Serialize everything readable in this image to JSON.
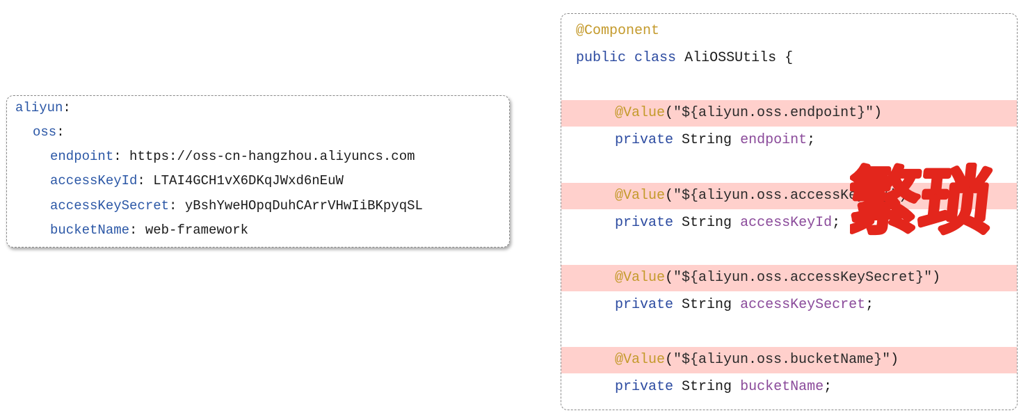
{
  "yaml": {
    "root_key": "aliyun",
    "oss_key": "oss",
    "entries": [
      {
        "key": "endpoint",
        "value": "https://oss-cn-hangzhou.aliyuncs.com"
      },
      {
        "key": "accessKeyId",
        "value": "LTAI4GCH1vX6DKqJWxd6nEuW"
      },
      {
        "key": "accessKeySecret",
        "value": "yBshYweHOpqDuhCArrVHwIiBKpyqSL"
      },
      {
        "key": "bucketName",
        "value": "web-framework"
      }
    ]
  },
  "code": {
    "annotation_component": "@Component",
    "class_decl": {
      "modifier": "public",
      "keyword": "class",
      "name": "AliOSSUtils",
      "brace": "{"
    },
    "fields": [
      {
        "annotation": "@Value",
        "expr": "\"${aliyun.oss.endpoint}\"",
        "modifier": "private",
        "type": "String",
        "name": "endpoint"
      },
      {
        "annotation": "@Value",
        "expr": "\"${aliyun.oss.accessKeyId}\"",
        "modifier": "private",
        "type": "String",
        "name": "accessKeyId"
      },
      {
        "annotation": "@Value",
        "expr": "\"${aliyun.oss.accessKeySecret}\"",
        "modifier": "private",
        "type": "String",
        "name": "accessKeySecret"
      },
      {
        "annotation": "@Value",
        "expr": "\"${aliyun.oss.bucketName}\"",
        "modifier": "private",
        "type": "String",
        "name": "bucketName"
      }
    ]
  },
  "stamp": {
    "text": "繁琐",
    "color": "#e3261c"
  },
  "colors": {
    "highlight": "#ffd0cc",
    "annotation": "#c49a2c",
    "keyword": "#2b4aa0",
    "field": "#8a4a9a",
    "yaml_key": "#2b57a6"
  }
}
